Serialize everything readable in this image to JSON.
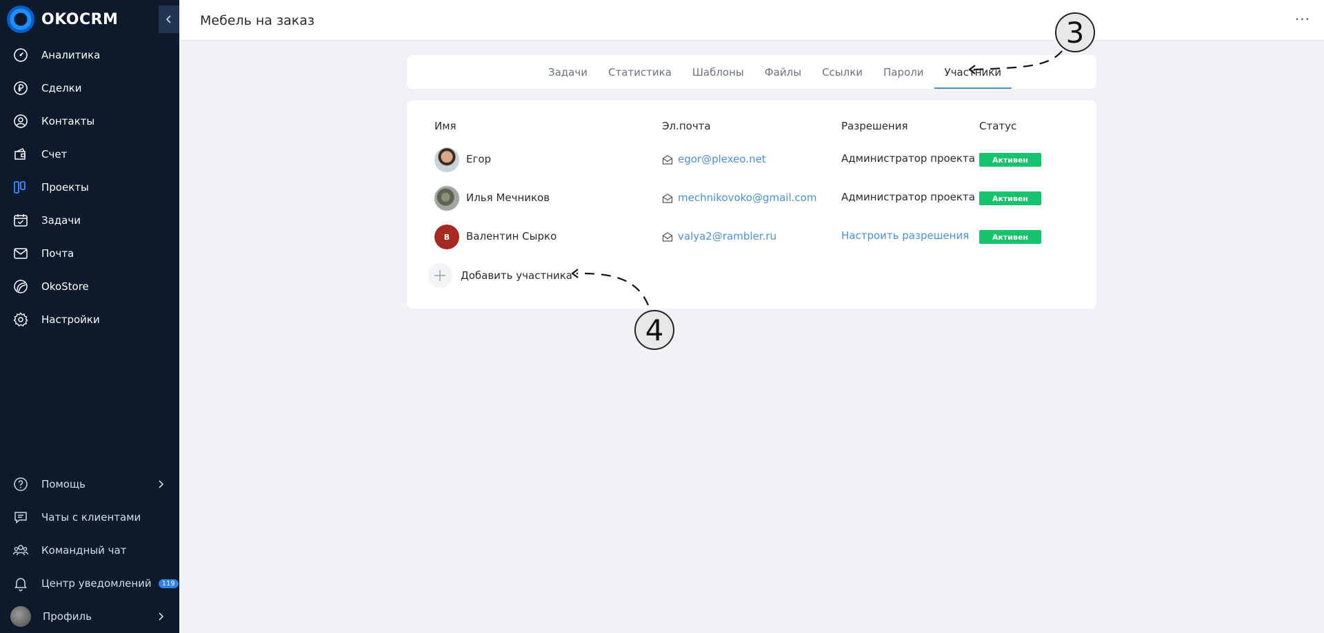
{
  "app": {
    "brand": "OKOCRM"
  },
  "sidebar": {
    "items": [
      {
        "label": "Аналитика",
        "icon": "gauge-icon"
      },
      {
        "label": "Сделки",
        "icon": "ruble-icon"
      },
      {
        "label": "Контакты",
        "icon": "user-circle-icon"
      },
      {
        "label": "Счет",
        "icon": "wallet-icon"
      },
      {
        "label": "Проекты",
        "icon": "kanban-icon"
      },
      {
        "label": "Задачи",
        "icon": "calendar-check-icon"
      },
      {
        "label": "Почта",
        "icon": "envelope-icon"
      },
      {
        "label": "OkoStore",
        "icon": "store-icon"
      },
      {
        "label": "Настройки",
        "icon": "gear-icon"
      }
    ],
    "bottom": {
      "help": "Помощь",
      "client_chats": "Чаты с клиентами",
      "team_chat": "Командный чат",
      "notifications": "Центр уведомлений",
      "notifications_count": "119",
      "profile": "Профиль"
    }
  },
  "header": {
    "title": "Мебель на заказ",
    "more": "···"
  },
  "tabs": [
    {
      "label": "Задачи",
      "active": false
    },
    {
      "label": "Статистика",
      "active": false
    },
    {
      "label": "Шаблоны",
      "active": false
    },
    {
      "label": "Файлы",
      "active": false
    },
    {
      "label": "Ссылки",
      "active": false
    },
    {
      "label": "Пароли",
      "active": false
    },
    {
      "label": "Участники",
      "active": true
    }
  ],
  "members": {
    "columns": {
      "name": "Имя",
      "email": "Эл.почта",
      "permissions": "Разрешения",
      "status": "Статус"
    },
    "rows": [
      {
        "name": "Егор",
        "email": "egor@plexeo.net",
        "permission": "Администратор проекта",
        "status": "Активен"
      },
      {
        "name": "Илья Мечников",
        "email": "mechnikovoko@gmail.com",
        "permission": "Администратор проекта",
        "status": "Активен"
      },
      {
        "name": "Валентин Сырко",
        "initial": "В",
        "email": "valya2@rambler.ru",
        "permission": "Настроить разрешения",
        "status": "Активен"
      }
    ],
    "add_label": "Добавить участника"
  },
  "annotations": {
    "callout_3": "3",
    "callout_4": "4"
  },
  "colors": {
    "sidebar_bg": "#0c1a2c",
    "accent": "#4a90d9",
    "status_active": "#14c36b"
  }
}
